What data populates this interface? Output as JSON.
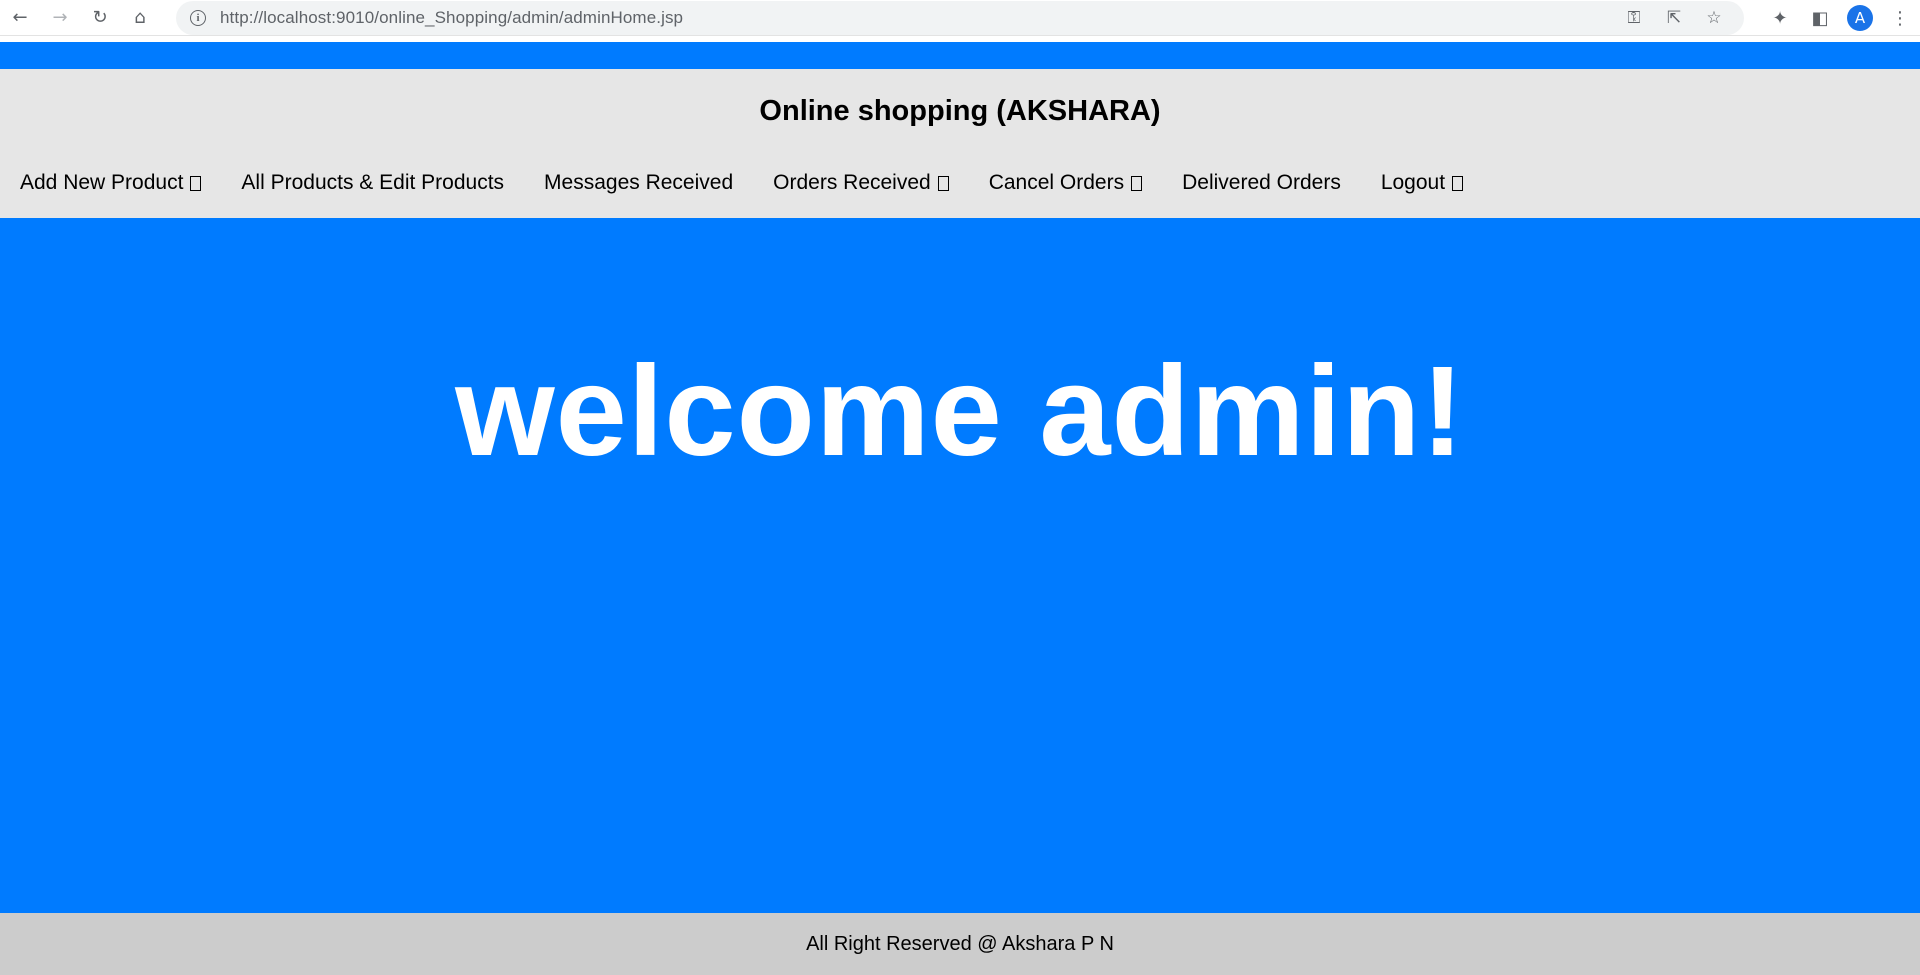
{
  "browser": {
    "url": "http://localhost:9010/online_Shopping/admin/adminHome.jsp",
    "back_icon": "←",
    "forward_icon": "→",
    "reload_icon": "↻",
    "home_icon": "⌂",
    "info_icon": "i",
    "key_icon": "⚿",
    "share_icon": "⇱",
    "star_icon": "☆",
    "extensions_icon": "✦",
    "sidepanel_icon": "◧",
    "avatar_letter": "A",
    "menu_icon": "⋮"
  },
  "header": {
    "title": "Online shopping (AKSHARA)"
  },
  "nav": {
    "items": [
      {
        "label": "Add New Product",
        "has_glyph": true
      },
      {
        "label": "All Products & Edit Products",
        "has_glyph": false
      },
      {
        "label": "Messages Received",
        "has_glyph": false
      },
      {
        "label": "Orders Received",
        "has_glyph": true
      },
      {
        "label": "Cancel Orders",
        "has_glyph": true
      },
      {
        "label": "Delivered Orders",
        "has_glyph": false
      },
      {
        "label": "Logout",
        "has_glyph": true
      }
    ]
  },
  "main": {
    "welcome": "welcome admin!"
  },
  "footer": {
    "text": "All Right Reserved @ Akshara P N"
  },
  "colors": {
    "accent": "#007bff",
    "header_bg": "#e6e6e6",
    "footer_bg": "#cccccc"
  }
}
